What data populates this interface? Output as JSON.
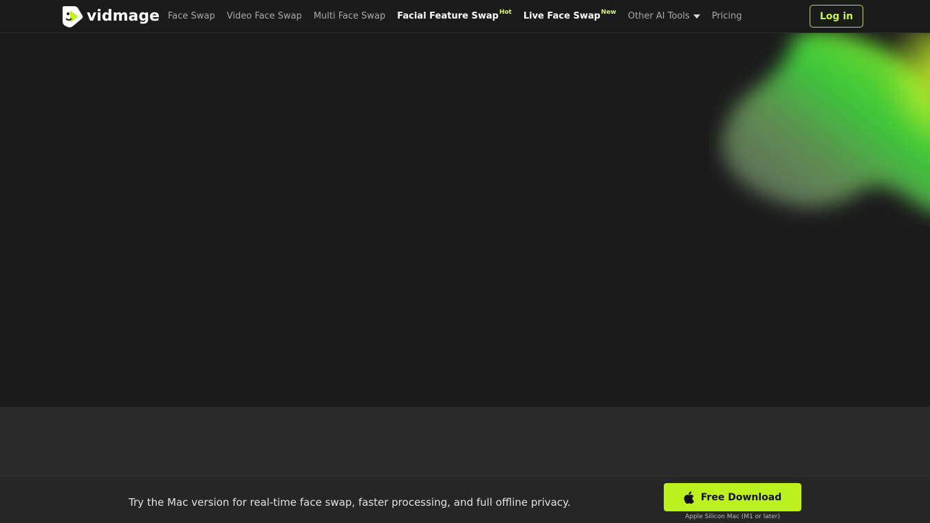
{
  "header": {
    "logo_text": "vidmage",
    "nav": [
      {
        "label": "Face Swap"
      },
      {
        "label": "Video Face Swap"
      },
      {
        "label": "Multi Face Swap"
      },
      {
        "label": "Facial Feature Swap",
        "badge": "Hot"
      },
      {
        "label": "Live Face Swap",
        "badge": "New"
      },
      {
        "label": "Other AI Tools"
      },
      {
        "label": "Pricing"
      }
    ],
    "login_label": "Log in"
  },
  "promo": {
    "text": "Try the Mac version for real-time face swap, faster processing, and full offline privacy.",
    "download_label": "Free Download",
    "download_note": "Apple Silicon Mac (M1 or later)"
  },
  "colors": {
    "background": "#1b1b1b",
    "accent": "#bef21f",
    "mid_band": "#2a2a2a"
  },
  "icons": [
    "vidmage-logo-icon",
    "chevron-down-icon",
    "apple-icon"
  ]
}
